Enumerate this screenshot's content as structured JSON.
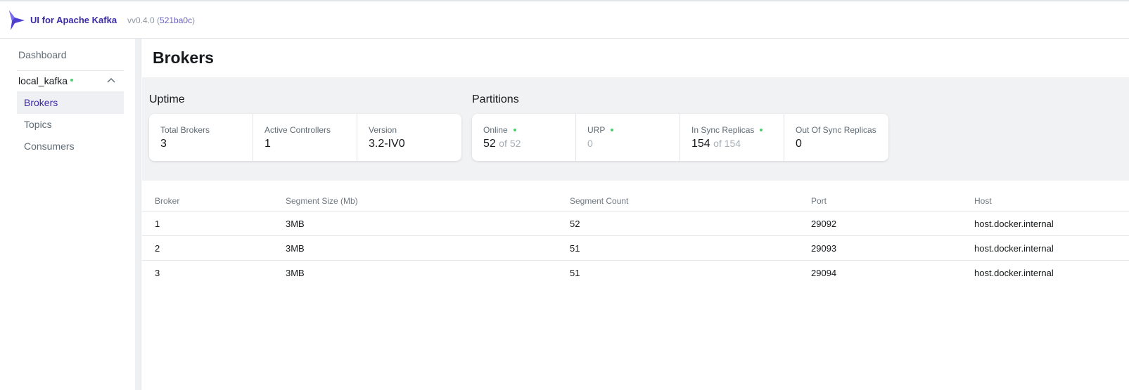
{
  "header": {
    "app_title": "UI for Apache Kafka",
    "version_prefix": "vv0.4.0 (",
    "commit": "521ba0c",
    "version_suffix": ")",
    "brand_color": "#3b2aa8"
  },
  "sidebar": {
    "dashboard": "Dashboard",
    "cluster": "local_kafka",
    "items": [
      {
        "label": "Brokers",
        "active": true
      },
      {
        "label": "Topics",
        "active": false
      },
      {
        "label": "Consumers",
        "active": false
      }
    ]
  },
  "page": {
    "title": "Brokers"
  },
  "stats": {
    "uptime": {
      "label": "Uptime",
      "cards": [
        {
          "label": "Total Brokers",
          "value": "3"
        },
        {
          "label": "Active Controllers",
          "value": "1"
        },
        {
          "label": "Version",
          "value": "3.2-IV0"
        }
      ]
    },
    "partitions": {
      "label": "Partitions",
      "cards": [
        {
          "label": "Online",
          "value": "52",
          "suffix": "of 52"
        },
        {
          "label": "URP",
          "value": "0"
        },
        {
          "label": "In Sync Replicas",
          "value": "154",
          "suffix": "of 154"
        },
        {
          "label": "Out Of Sync Replicas",
          "value": "0"
        }
      ]
    }
  },
  "table": {
    "columns": [
      "Broker",
      "Segment Size (Mb)",
      "Segment Count",
      "Port",
      "Host"
    ],
    "rows": [
      [
        "1",
        "3MB",
        "52",
        "29092",
        "host.docker.internal"
      ],
      [
        "2",
        "3MB",
        "51",
        "29093",
        "host.docker.internal"
      ],
      [
        "3",
        "3MB",
        "51",
        "29094",
        "host.docker.internal"
      ]
    ]
  }
}
